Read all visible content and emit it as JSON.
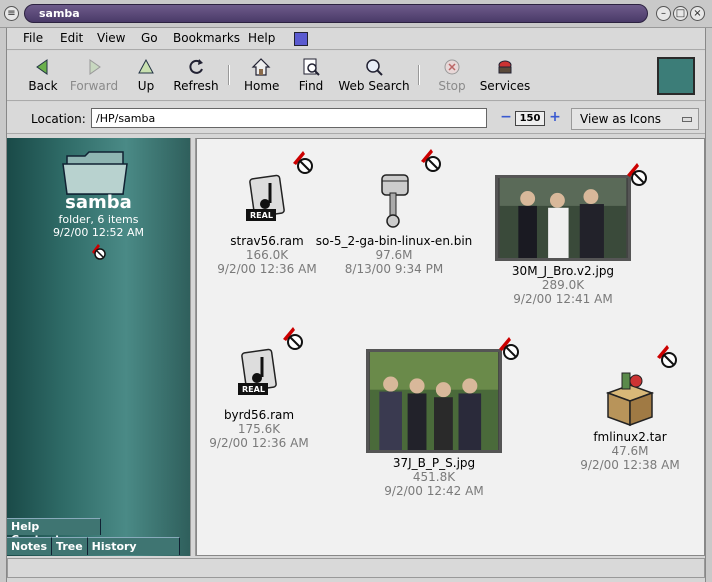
{
  "window": {
    "title": "samba"
  },
  "menu": [
    "File",
    "Edit",
    "View",
    "Go",
    "Bookmarks",
    "Help"
  ],
  "toolbar": {
    "back": "Back",
    "forward": "Forward",
    "up": "Up",
    "refresh": "Refresh",
    "home": "Home",
    "find": "Find",
    "web_search": "Web Search",
    "stop": "Stop",
    "services": "Services"
  },
  "location": {
    "label": "Location:",
    "value": "/HP/samba"
  },
  "zoom": {
    "level": "150"
  },
  "view": {
    "selected": "View as Icons"
  },
  "sidebar": {
    "folder_name": "samba",
    "info": "folder, 6 items",
    "date": "9/2/00 12:52 AM",
    "tabs": {
      "help": "Help Contents",
      "notes": "Notes",
      "tree": "Tree",
      "history": "History"
    }
  },
  "files": [
    {
      "name": "strav56.ram",
      "size": "166.0K",
      "date": "9/2/00 12:36 AM",
      "icon": "realaudio-icon"
    },
    {
      "name": "so-5_2-ga-bin-linux-en.bin",
      "size": "97.6M",
      "date": "8/13/00 9:34 PM",
      "icon": "piston-icon"
    },
    {
      "name": "30M_J_Bro.v2.jpg",
      "size": "289.0K",
      "date": "9/2/00 12:41 AM",
      "icon": "photo-thumbnail"
    },
    {
      "name": "byrd56.ram",
      "size": "175.6K",
      "date": "9/2/00 12:36 AM",
      "icon": "realaudio-icon"
    },
    {
      "name": "37J_B_P_S.jpg",
      "size": "451.8K",
      "date": "9/2/00 12:42 AM",
      "icon": "photo-thumbnail"
    },
    {
      "name": "fmlinux2.tar",
      "size": "47.6M",
      "date": "9/2/00 12:38 AM",
      "icon": "package-box-icon"
    }
  ],
  "colors": {
    "title_bar": "#5a4a78",
    "sidebar": "#2e6a66",
    "emblem_red": "#cc0000"
  }
}
